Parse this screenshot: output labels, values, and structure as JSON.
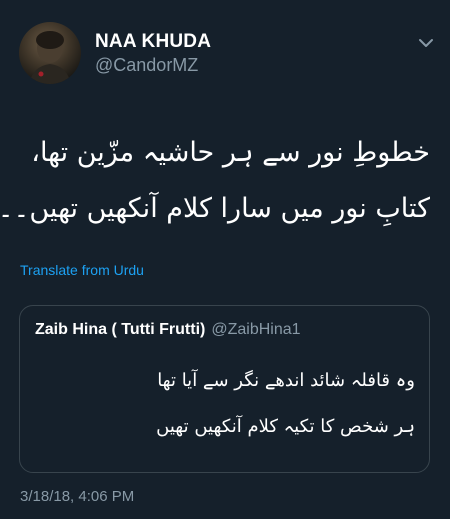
{
  "author": {
    "display_name": "NAA KHUDA",
    "handle": "@CandorMZ",
    "avatar_icon": "profile-photo"
  },
  "menu_icon": "chevron-down-icon",
  "tweet": {
    "lines": [
      "خطوطِ نور سے ہر حاشیہ مزّین تھا،",
      "کتابِ نور میں سارا کلام آنکھیں تھیں۔۔"
    ],
    "translate_label": "Translate from Urdu"
  },
  "quoted_tweet": {
    "display_name": "Zaib Hina ( Tutti Frutti)",
    "handle": "@ZaibHina1",
    "lines": [
      "وہ قافلہ شائد اندھے نگر سے آیا تھا",
      "ہر شخص کا تکیہ کلام آنکھیں تھیں"
    ]
  },
  "timestamp": "3/18/18, 4:06 PM",
  "colors": {
    "background": "#15202b",
    "secondary_text": "#8899a6",
    "link": "#1da1f2",
    "border": "#38444d"
  }
}
